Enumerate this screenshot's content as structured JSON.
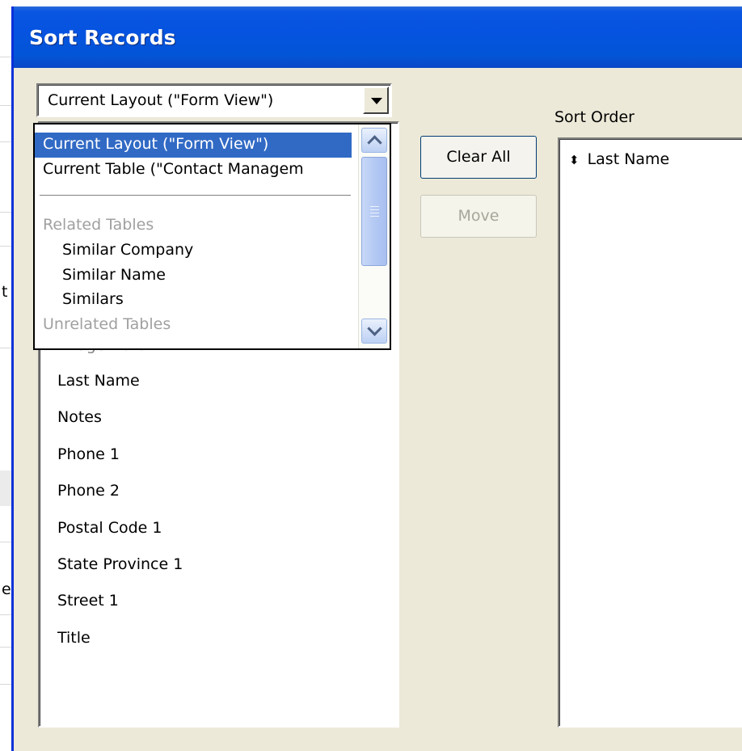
{
  "window": {
    "title": "Sort Records"
  },
  "background": {
    "left_chars": [
      "t",
      "e"
    ]
  },
  "combo": {
    "selected": "Current Layout (\"Form View\")",
    "options": [
      {
        "label": "Current Layout (\"Form View\")",
        "kind": "selected"
      },
      {
        "label": "Current Table (\"Contact Managem",
        "kind": "option"
      },
      {
        "label": "Related Tables",
        "kind": "header"
      },
      {
        "label": "Similar Company",
        "kind": "sub"
      },
      {
        "label": "Similar Name",
        "kind": "sub"
      },
      {
        "label": "Similars",
        "kind": "sub"
      },
      {
        "label": "Unrelated Tables",
        "kind": "header"
      }
    ]
  },
  "fields": {
    "partially_hidden": "Image Data",
    "items": [
      "Last Name",
      "Notes",
      "Phone 1",
      "Phone 2",
      "Postal Code 1",
      "State Province 1",
      "Street 1",
      "Title"
    ]
  },
  "buttons": {
    "clear_all": "Clear All",
    "move": "Move"
  },
  "sort_order": {
    "label": "Sort Order",
    "items": [
      {
        "icon": "sort-handle-icon",
        "glyph": "⬍",
        "label": "Last Name"
      }
    ]
  },
  "colors": {
    "titlebar": "#0553e0",
    "selection": "#316ac5",
    "dialog_bg": "#ece9d8"
  }
}
